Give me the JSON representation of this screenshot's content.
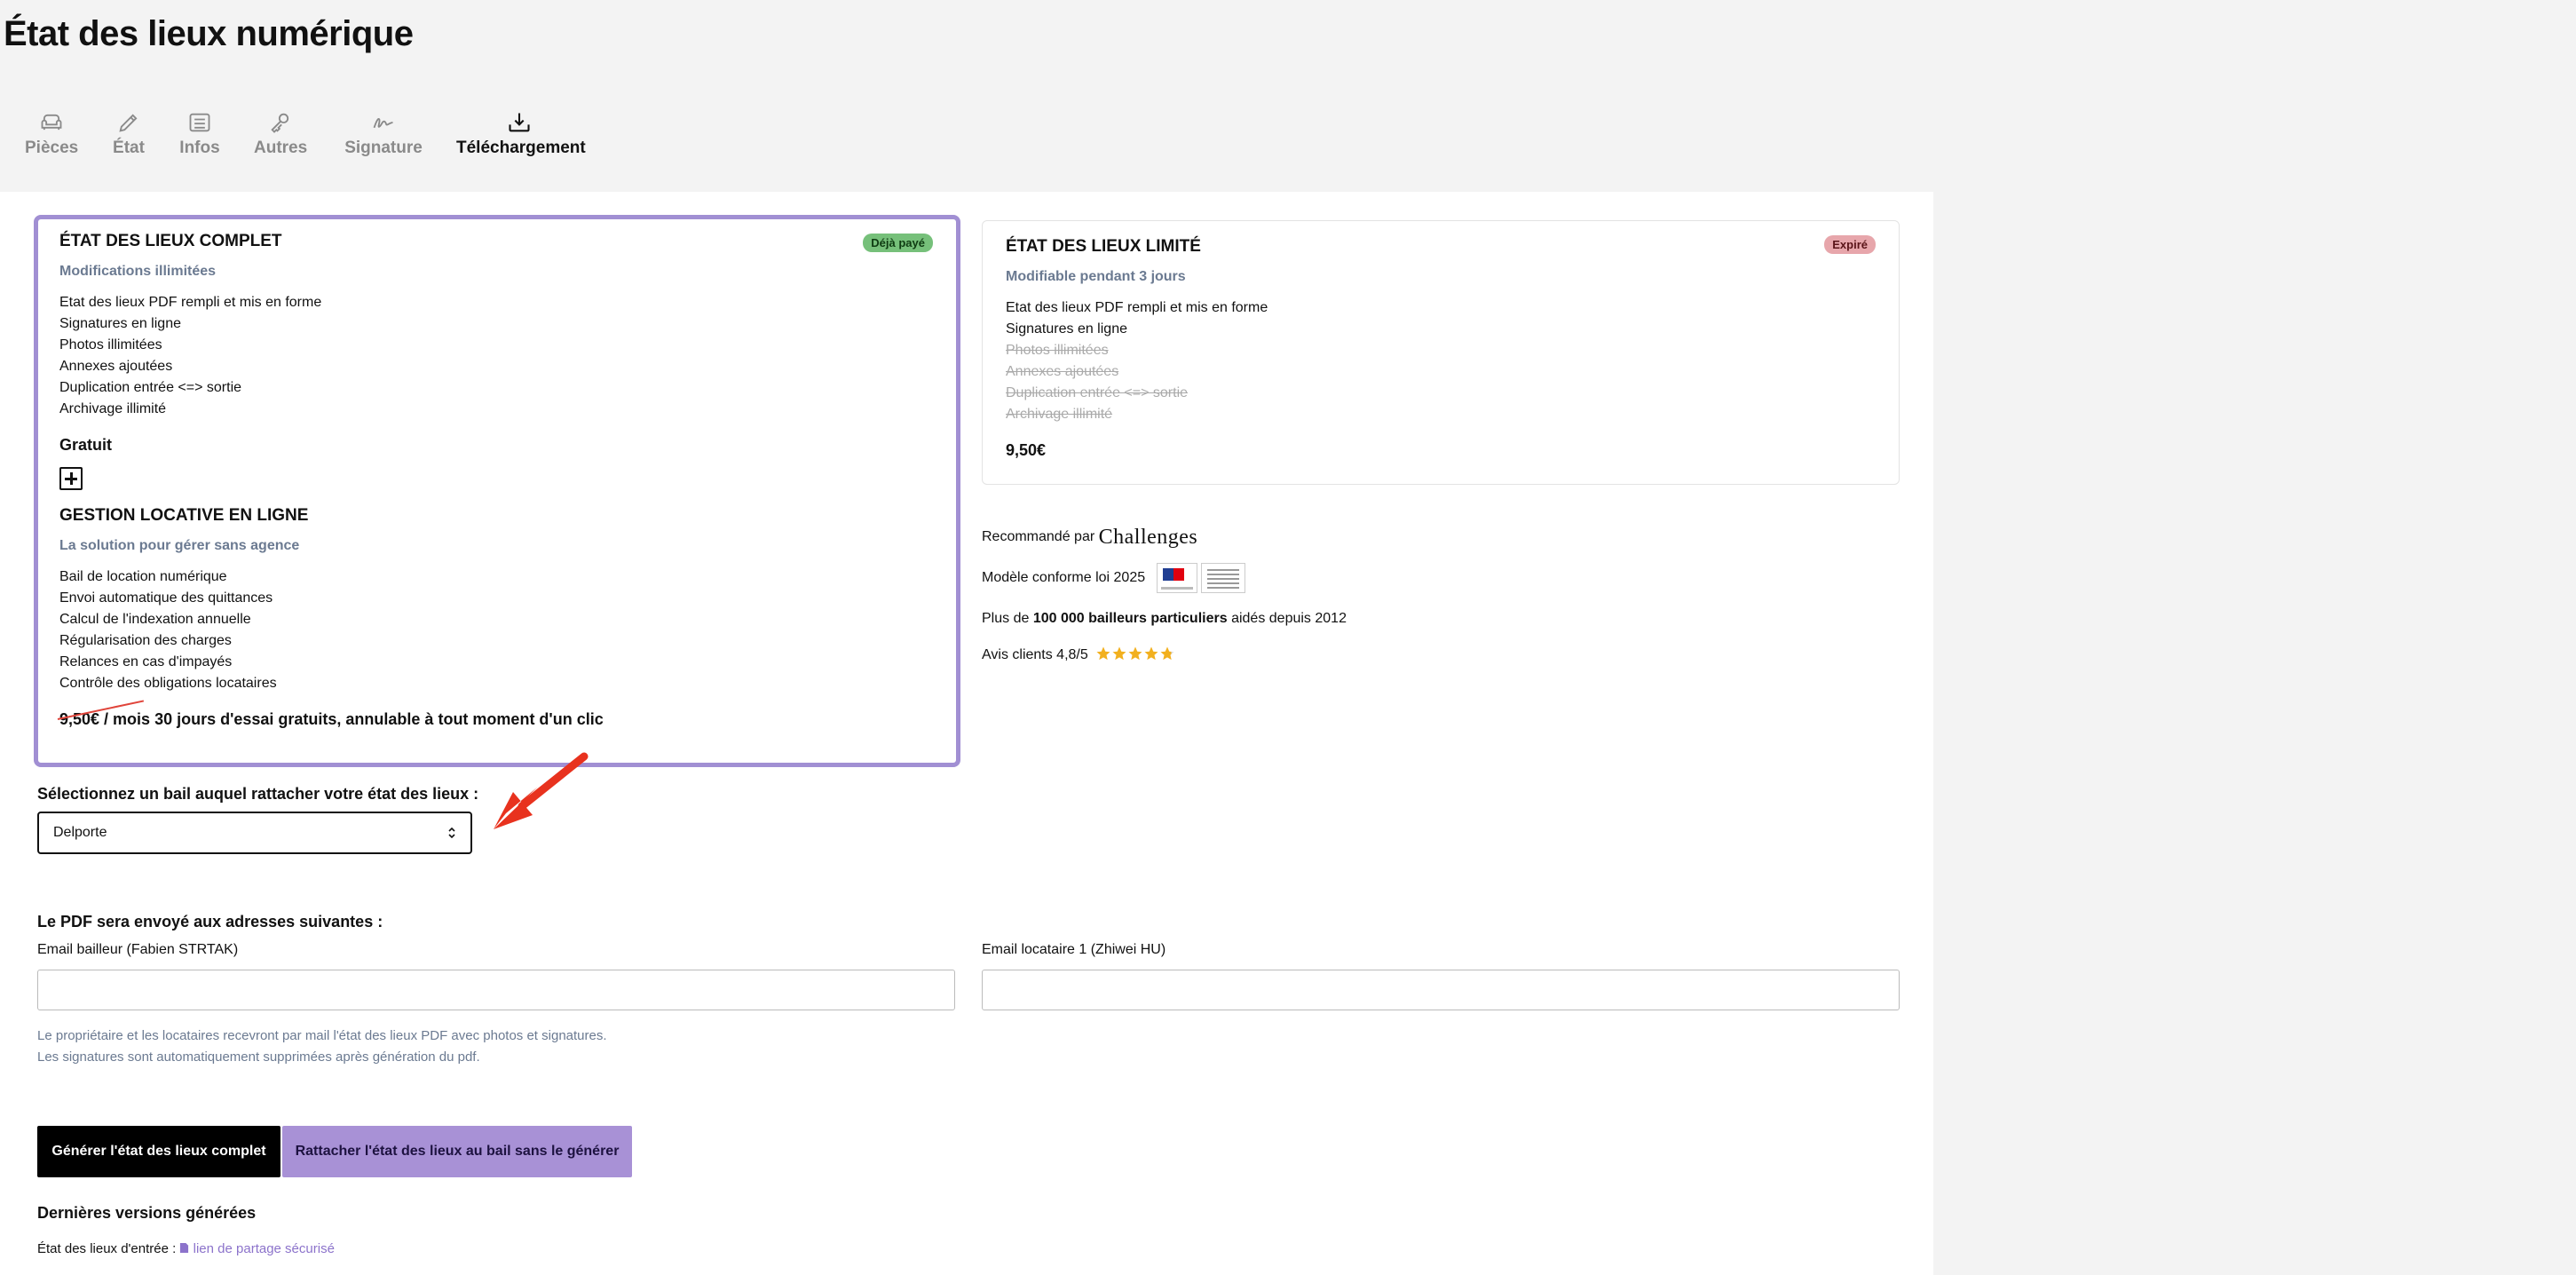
{
  "page": {
    "title": "État des lieux numérique"
  },
  "tabs": [
    {
      "label": "Pièces",
      "icon": "sofa-icon"
    },
    {
      "label": "État",
      "icon": "pencil-icon"
    },
    {
      "label": "Infos",
      "icon": "list-icon"
    },
    {
      "label": "Autres",
      "icon": "key-icon"
    },
    {
      "label": "Signature",
      "icon": "signature-icon"
    },
    {
      "label": "Téléchargement",
      "icon": "download-icon"
    }
  ],
  "plan_complete": {
    "title": "ÉTAT DES LIEUX COMPLET",
    "badge": "Déjà payé",
    "subtitle": "Modifications illimitées",
    "features": [
      "Etat des lieux PDF rempli et mis en forme",
      "Signatures en ligne",
      "Photos illimitées",
      "Annexes ajoutées",
      "Duplication entrée <=> sortie",
      "Archivage illimité"
    ],
    "price": "Gratuit",
    "addon": {
      "title": "GESTION LOCATIVE EN LIGNE",
      "subtitle": "La solution pour gérer sans agence",
      "features": [
        "Bail de location numérique",
        "Envoi automatique des quittances",
        "Calcul de l'indexation annuelle",
        "Régularisation des charges",
        "Relances en cas d'impayés",
        "Contrôle des obligations locataires"
      ],
      "old_price": "9,50€",
      "price_text": " / mois 30 jours d'essai gratuits, annulable à tout moment d'un clic"
    }
  },
  "plan_limited": {
    "title": "ÉTAT DES LIEUX LIMITÉ",
    "badge": "Expiré",
    "subtitle": "Modifiable pendant 3 jours",
    "features": [
      "Etat des lieux PDF rempli et mis en forme",
      "Signatures en ligne"
    ],
    "disabled_features": [
      "Photos illimitées",
      "Annexes ajoutées",
      "Duplication entrée <=> sortie",
      "Archivage illimité"
    ],
    "price": "9,50€"
  },
  "trust": {
    "recommended_prefix": "Recommandé par",
    "recommended_logo": "Challenges",
    "compliance": "Modèle conforme loi 2025",
    "users_prefix": "Plus de",
    "users_bold": "100 000 bailleurs particuliers",
    "users_suffix": "aidés depuis 2012",
    "rating_text": "Avis clients 4,8/5",
    "rating": 4.8
  },
  "lease_select": {
    "label": "Sélectionnez un bail auquel rattacher votre état des lieux :",
    "value": "Delporte"
  },
  "emails": {
    "heading": "Le PDF sera envoyé aux adresses suivantes :",
    "landlord_label": "Email bailleur (Fabien STRTAK)",
    "landlord_value": "",
    "tenant_label": "Email locataire 1 (Zhiwei HU)",
    "tenant_value": "",
    "help_line1": "Le propriétaire et les locataires recevront par mail l'état des lieux PDF avec photos et signatures.",
    "help_line2": "Les signatures sont automatiquement supprimées après génération du pdf."
  },
  "actions": {
    "generate": "Générer l'état des lieux complet",
    "attach": "Rattacher l'état des lieux au bail sans le générer"
  },
  "versions": {
    "heading": "Dernières versions générées",
    "entry_label": "État des lieux d'entrée :",
    "entry_link": "lien de partage sécurisé"
  },
  "colors": {
    "accent": "#a18fd3",
    "button_primary": "#000000",
    "button_secondary": "#a891d6",
    "badge_paid": "#76c07a",
    "badge_expired": "#e7a6ab",
    "annotation_arrow": "#e8321e"
  }
}
